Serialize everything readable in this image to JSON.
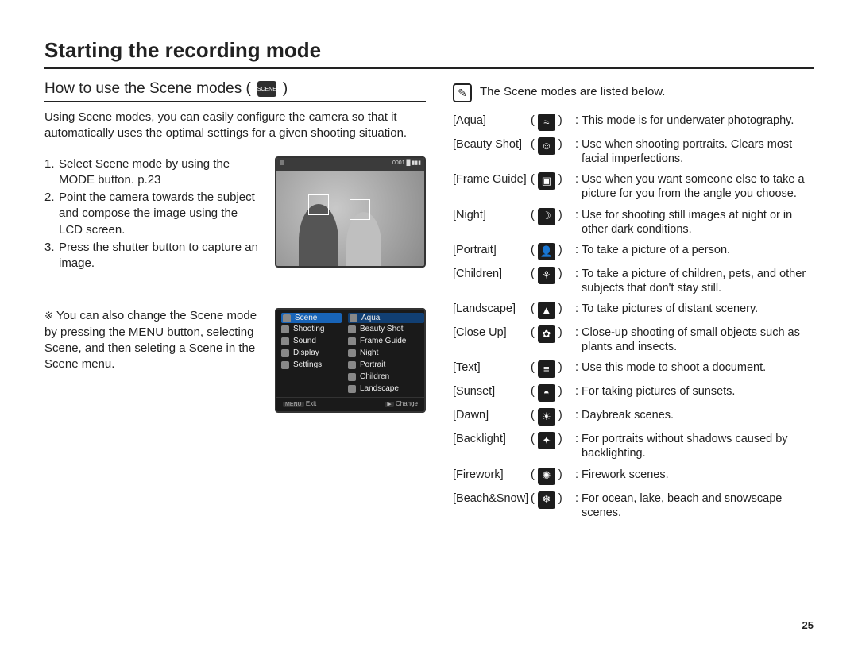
{
  "page_title": "Starting the recording mode",
  "page_number": "25",
  "sub_title": "How to use the Scene modes (",
  "sub_title_after": ")",
  "scene_chip_label": "SCENE",
  "intro": "Using Scene modes, you can easily configure the camera so that it automatically uses the optimal settings for a given shooting situation.",
  "steps": [
    "Select Scene mode by using the MODE button. p.23",
    "Point the camera towards the subject and compose the image using the LCD screen.",
    "Press the shutter button to capture an image."
  ],
  "note_text": "You can also change the Scene mode by pressing the MENU button, selecting Scene, and then seleting a Scene in the Scene menu.",
  "note_symbol": "※",
  "menu": {
    "left": [
      "Scene",
      "Shooting",
      "Sound",
      "Display",
      "Settings"
    ],
    "right": [
      "Aqua",
      "Beauty Shot",
      "Frame Guide",
      "Night",
      "Portrait",
      "Children",
      "Landscape"
    ],
    "footer_left_key": "MENU",
    "footer_left": "Exit",
    "footer_right_key": "▶",
    "footer_right": "Change"
  },
  "scene_list_heading": "The Scene modes are listed below.",
  "note_icon_glyph": "✎",
  "scenes": [
    {
      "label": "[Aqua]",
      "glyph": "≈",
      "desc": "This mode is for underwater photography."
    },
    {
      "label": "[Beauty Shot]",
      "glyph": "☺",
      "desc": "Use when shooting portraits. Clears most facial imperfections."
    },
    {
      "label": "[Frame Guide]",
      "glyph": "▣",
      "desc": "Use when you want someone else to take a picture for you from the angle you choose."
    },
    {
      "label": "[Night]",
      "glyph": "☽",
      "desc": "Use for shooting still images at night or in other dark conditions."
    },
    {
      "label": "[Portrait]",
      "glyph": "👤",
      "desc": "To take a picture of a person."
    },
    {
      "label": "[Children]",
      "glyph": "⚘",
      "desc": "To take a picture of children, pets, and other subjects that don't stay still."
    },
    {
      "label": "[Landscape]",
      "glyph": "▲",
      "desc": "To take pictures of distant scenery."
    },
    {
      "label": "[Close Up]",
      "glyph": "✿",
      "desc": "Close-up shooting of small objects such as plants and insects."
    },
    {
      "label": "[Text]",
      "glyph": "≡",
      "desc": "Use this mode to shoot a document."
    },
    {
      "label": "[Sunset]",
      "glyph": "◓",
      "desc": "For taking pictures of sunsets."
    },
    {
      "label": "[Dawn]",
      "glyph": "☀",
      "desc": "Daybreak scenes."
    },
    {
      "label": "[Backlight]",
      "glyph": "✦",
      "desc": "For portraits without shadows caused by backlighting."
    },
    {
      "label": "[Firework]",
      "glyph": "✺",
      "desc": "Firework scenes."
    },
    {
      "label": "[Beach&Snow]",
      "glyph": "❄",
      "desc": "For ocean, lake, beach and snowscape scenes."
    }
  ]
}
